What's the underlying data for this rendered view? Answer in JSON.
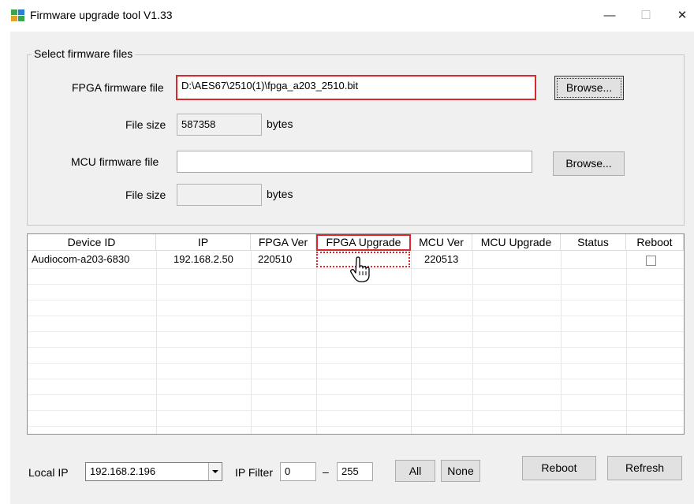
{
  "window": {
    "title": "Firmware upgrade tool V1.33",
    "minimize_glyph": "—",
    "maximize_glyph": "☐",
    "close_glyph": "✕"
  },
  "files_group": {
    "title": "Select firmware files",
    "fpga_label": "FPGA firmware file",
    "fpga_path": "D:\\AES67\\2510(1)\\fpga_a203_2510.bit",
    "fpga_browse": "Browse...",
    "fpga_size_label": "File size",
    "fpga_size": "587358",
    "fpga_size_unit": "bytes",
    "mcu_label": "MCU  firmware file",
    "mcu_path": "",
    "mcu_browse": "Browse...",
    "mcu_size_label": "File size",
    "mcu_size": "",
    "mcu_size_unit": "bytes"
  },
  "table": {
    "columns": [
      "Device ID",
      "IP",
      "FPGA Ver",
      "FPGA Upgrade",
      "MCU Ver",
      "MCU Upgrade",
      "Status",
      "Reboot"
    ],
    "rows": [
      {
        "device_id": "Audiocom-a203-6830",
        "ip": "192.168.2.50",
        "fpga_ver": "220510",
        "fpga_upgrade": "",
        "mcu_ver": "220513",
        "mcu_upgrade": "",
        "status": "",
        "reboot_checked": false
      }
    ]
  },
  "bottom": {
    "local_ip_label": "Local IP",
    "local_ip_value": "192.168.2.196",
    "ip_filter_label": "IP Filter",
    "ip_filter_from": "0",
    "ip_filter_dash": "–",
    "ip_filter_to": "255",
    "all_label": "All",
    "none_label": "None",
    "reboot_label": "Reboot",
    "refresh_label": "Refresh"
  },
  "colors": {
    "highlight": "#d9282e",
    "window_bg": "#f0f0f0"
  },
  "icons": {
    "app": "app-tiles-icon",
    "cursor": "hand-pointer-icon",
    "dropdown": "chevron-down-icon"
  }
}
